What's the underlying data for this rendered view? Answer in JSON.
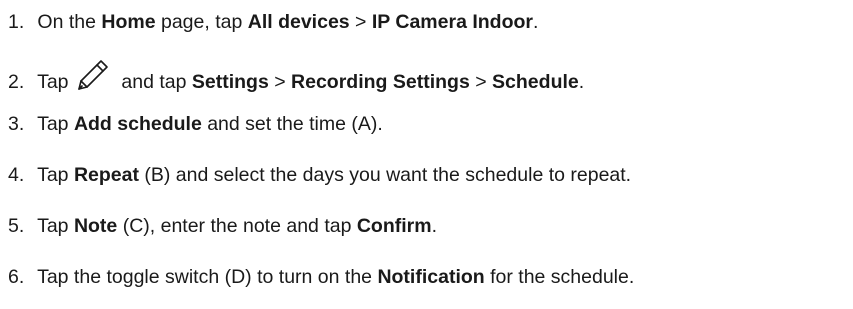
{
  "steps": [
    {
      "number": "1.",
      "parts": [
        "On the ",
        "Home",
        " page, tap ",
        "All devices",
        " > ",
        "IP Camera Indoor",
        "."
      ]
    },
    {
      "number": "2.",
      "icon": "pencil-icon",
      "parts": [
        "Tap",
        "and tap ",
        "Settings",
        " > ",
        "Recording Settings",
        " > ",
        "Schedule",
        "."
      ]
    },
    {
      "number": "3.",
      "parts": [
        "Tap ",
        "Add schedule",
        " and set the time (A)."
      ]
    },
    {
      "number": "4.",
      "parts": [
        "Tap ",
        "Repeat",
        " (B) and select the days you want the schedule to repeat."
      ]
    },
    {
      "number": "5.",
      "parts": [
        "Tap ",
        "Note",
        " (C), enter the note and tap ",
        "Confirm",
        "."
      ]
    },
    {
      "number": "6.",
      "parts": [
        "Tap the toggle switch (D) to turn on the ",
        "Notification",
        " for the schedule."
      ]
    }
  ]
}
